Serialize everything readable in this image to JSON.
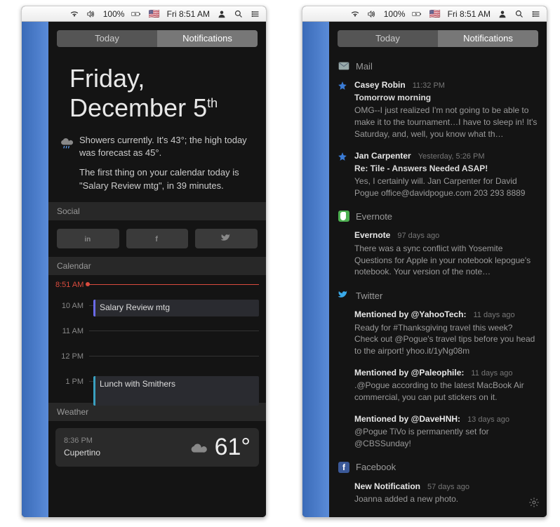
{
  "menubar": {
    "battery_pct": "100%",
    "clock": "Fri 8:51 AM"
  },
  "tabs": {
    "today": "Today",
    "notifications": "Notifications"
  },
  "today": {
    "date_line1": "Friday,",
    "date_line2": "December 5",
    "date_suffix": "th",
    "weather_text": "Showers currently. It's 43°; the high today was forecast as 45°.",
    "calendar_blurb": "The first thing on your calendar today is \"Salary Review mtg\", in 39 minutes.",
    "sections": {
      "social": "Social",
      "calendar": "Calendar",
      "weather": "Weather"
    },
    "calendar": {
      "now_label": "8:51 AM",
      "hours": [
        "10 AM",
        "11 AM",
        "12 PM",
        "1 PM"
      ],
      "events": [
        {
          "title": "Salary Review mtg"
        },
        {
          "title": "Lunch with Smithers"
        }
      ]
    },
    "weather_card": {
      "time": "8:36 PM",
      "city": "Cupertino",
      "temp": "61°"
    }
  },
  "notifications": {
    "groups": [
      {
        "app": "Mail",
        "icon": "mail",
        "items": [
          {
            "icon": "star",
            "from": "Casey Robin",
            "meta": "11:32 PM",
            "subject": "Tomorrow morning",
            "body": "OMG--I just realized I'm not going to be able to make it to the tournament…I have to sleep in! It's Saturday, and, well, you know what th…"
          },
          {
            "icon": "star",
            "from": "Jan Carpenter",
            "meta": "Yesterday, 5:26 PM",
            "subject": "Re: Tile - Answers Needed ASAP!",
            "body": "Yes, I certainly will. Jan Carpenter for David Pogue office@davidpogue.com 203 293 8889"
          }
        ]
      },
      {
        "app": "Evernote",
        "icon": "evernote",
        "items": [
          {
            "from": "Evernote",
            "meta": "97 days ago",
            "body": "There was a sync conflict with Yosemite Questions for Apple in your notebook lepogue's notebook. Your version of the note…"
          }
        ]
      },
      {
        "app": "Twitter",
        "icon": "twitter",
        "items": [
          {
            "from": "Mentioned by @YahooTech:",
            "meta": "11 days ago",
            "body": "Ready for #Thanksgiving travel this week? Check out @Pogue's travel tips before you head to the airport! yhoo.it/1yNg08m"
          },
          {
            "from": "Mentioned by @Paleophile:",
            "meta": "11 days ago",
            "body": ".@Pogue according to the latest MacBook Air commercial, you can put stickers on it."
          },
          {
            "from": "Mentioned by @DaveHNH:",
            "meta": "13 days ago",
            "body": "@Pogue TiVo is permanently set for @CBSSunday!"
          }
        ]
      },
      {
        "app": "Facebook",
        "icon": "facebook",
        "items": [
          {
            "from": "New Notification",
            "meta": "57 days ago",
            "body": "Joanna added a new photo."
          }
        ]
      }
    ]
  }
}
